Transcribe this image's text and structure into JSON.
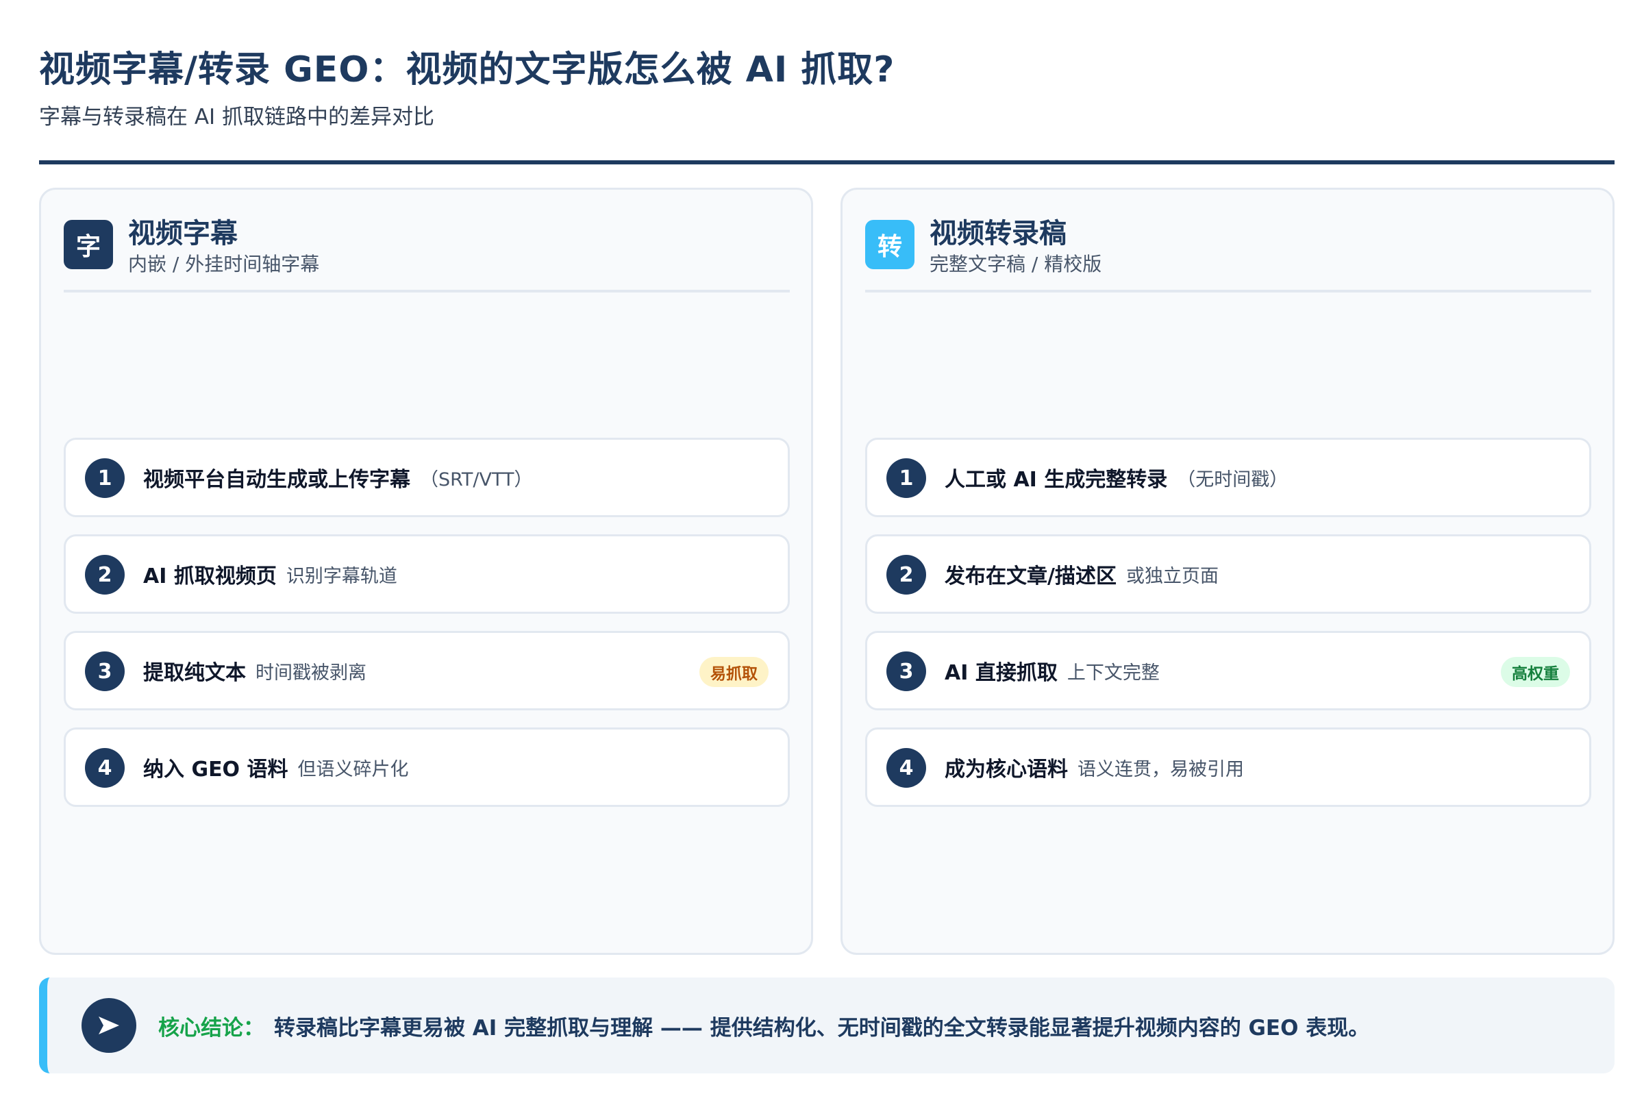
{
  "header": {
    "title": "视频字幕/转录 GEO：视频的文字版怎么被 AI 抓取?",
    "subtitle": "字幕与转录稿在 AI 抓取链路中的差异对比"
  },
  "left_panel": {
    "icon_char": "字",
    "title": "视频字幕",
    "subtitle": "内嵌 / 外挂时间轴字幕",
    "steps": [
      {
        "num": "1",
        "main": "视频平台自动生成或上传字幕",
        "note": "（SRT/VTT）"
      },
      {
        "num": "2",
        "main": "AI 抓取视频页",
        "note": "识别字幕轨道"
      },
      {
        "num": "3",
        "main": "提取纯文本",
        "note": "时间戳被剥离",
        "badge": "易抓取"
      },
      {
        "num": "4",
        "main": "纳入 GEO 语料",
        "note": "但语义碎片化"
      }
    ]
  },
  "right_panel": {
    "icon_char": "转",
    "title": "视频转录稿",
    "subtitle": "完整文字稿 / 精校版",
    "steps": [
      {
        "num": "1",
        "main": "人工或 AI 生成完整转录",
        "note": "（无时间戳）"
      },
      {
        "num": "2",
        "main": "发布在文章/描述区",
        "note": "或独立页面"
      },
      {
        "num": "3",
        "main": "AI 直接抓取",
        "note": "上下文完整",
        "badge": "高权重"
      },
      {
        "num": "4",
        "main": "成为核心语料",
        "note": "语义连贯，易被引用"
      }
    ]
  },
  "conclusion": {
    "label": "核心结论：",
    "body": "转录稿比字幕更易被 AI 完整抓取与理解 —— 提供结构化、无时间戳的全文转录能显著提升视频内容的 GEO 表现。"
  },
  "colors": {
    "navy": "#1e3a5f",
    "sky": "#38bdf8",
    "green": "#16a34a",
    "amber": "#b45309"
  }
}
